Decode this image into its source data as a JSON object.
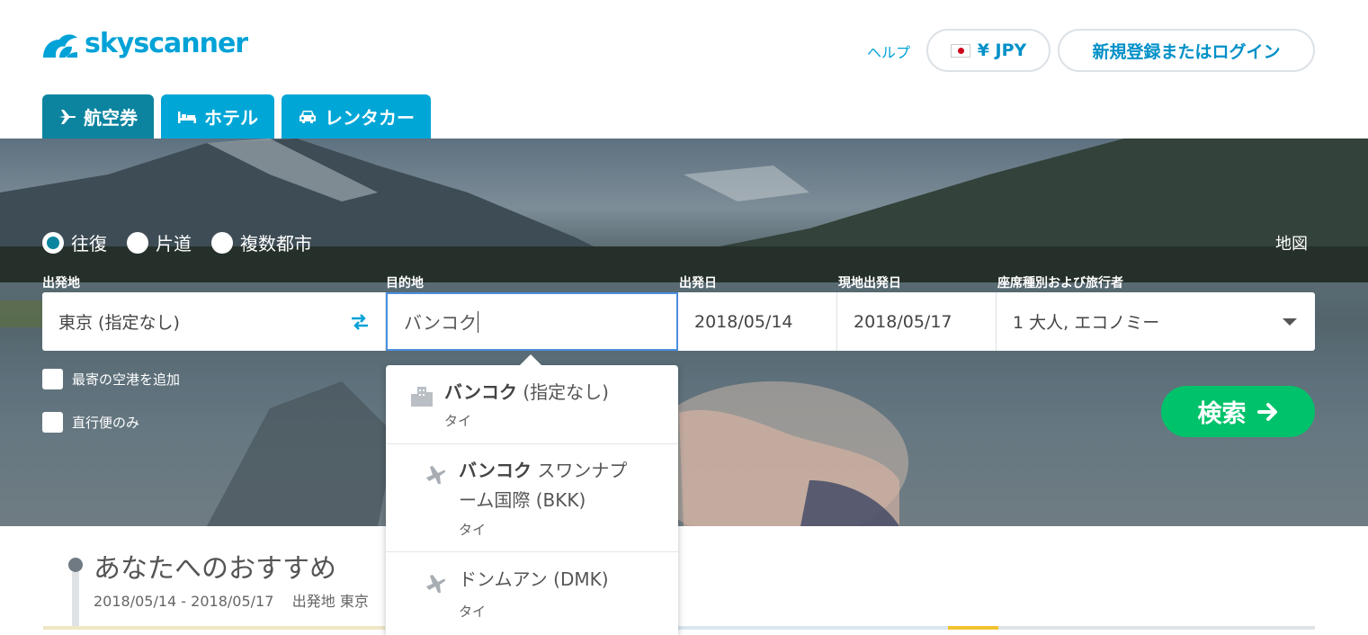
{
  "brand": {
    "name": "skyscanner"
  },
  "header": {
    "help": "ヘルプ",
    "currency": "¥ JPY",
    "login": "新規登録またはログイン"
  },
  "tabs": [
    {
      "label": "航空券",
      "icon": "plane-icon",
      "active": true
    },
    {
      "label": "ホテル",
      "icon": "bed-icon",
      "active": false
    },
    {
      "label": "レンタカー",
      "icon": "car-icon",
      "active": false
    }
  ],
  "trip_types": [
    {
      "label": "往復",
      "checked": true
    },
    {
      "label": "片道",
      "checked": false
    },
    {
      "label": "複数都市",
      "checked": false
    }
  ],
  "map_link": "地図",
  "labels": {
    "origin": "出発地",
    "destination": "目的地",
    "depart": "出発日",
    "return": "現地出発日",
    "cabin": "座席種別および旅行者"
  },
  "fields": {
    "origin": "東京 (指定なし)",
    "destination": "バンコク",
    "depart": "2018/05/14",
    "return": "2018/05/17",
    "cabin": "1 大人, エコノミー"
  },
  "checkboxes": {
    "nearby": "最寄の空港を追加",
    "direct": "直行便のみ"
  },
  "search_button": "検索",
  "suggestions": [
    {
      "bold": "バンコク",
      "rest": " (指定なし)",
      "country": "タイ",
      "icon": "city-icon"
    },
    {
      "bold": "バンコク",
      "rest": " スワンナプ",
      "rest2": "ーム国際 (BKK)",
      "country": "タイ",
      "icon": "plane-icon"
    },
    {
      "bold": "",
      "rest": "ドンムアン (DMK)",
      "country": "タイ",
      "icon": "plane-icon"
    }
  ],
  "recommend": {
    "title": "あなたへのおすすめ",
    "dates": "2018/05/14 - 2018/05/17",
    "origin": "出発地 東京"
  },
  "colors": {
    "brand": "#00a2d7",
    "tab": "#00a6d6",
    "tab_active": "#0c849f",
    "search": "#00c26a"
  }
}
